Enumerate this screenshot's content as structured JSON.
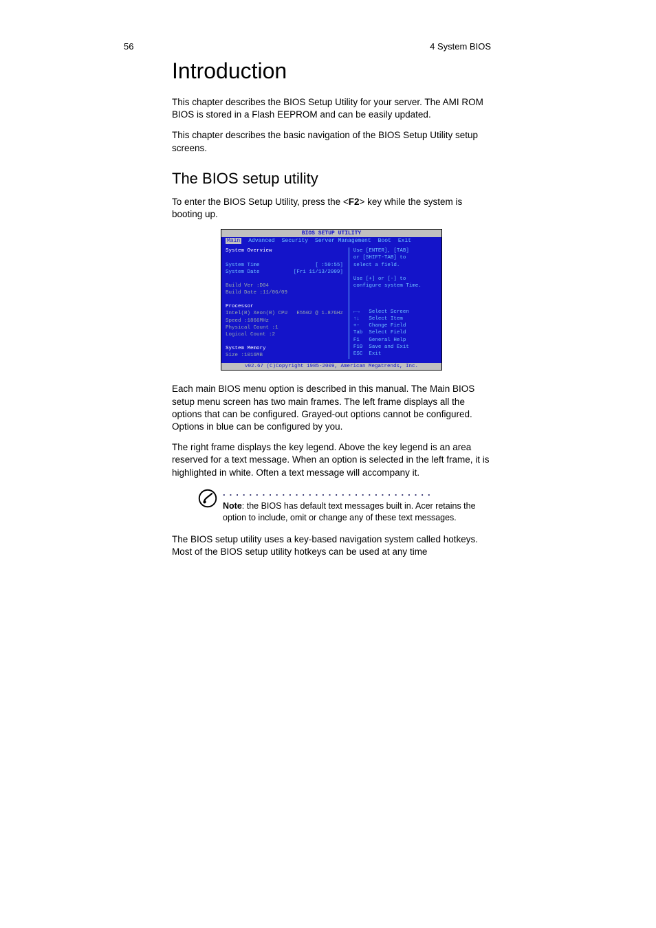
{
  "header": {
    "page_number": "56",
    "section": "4 System BIOS"
  },
  "title": "Introduction",
  "paragraphs": {
    "intro1": "This chapter describes the BIOS Setup Utility for your server. The AMI ROM BIOS is stored in a Flash EEPROM and can be easily updated.",
    "intro2": "This chapter describes the basic navigation of the BIOS Setup Utility setup screens.",
    "enter_pre": "To enter the BIOS Setup Utility, press the <",
    "enter_key": "F2",
    "enter_post": "> key while the system is booting up.",
    "desc1": "Each main BIOS menu option is described in this manual. The Main BIOS setup menu screen has two main frames. The left frame displays all the options that can be configured. Grayed-out options cannot be configured. Options in blue can be configured by you.",
    "desc2": "The right frame displays the key legend. Above the key legend is an area reserved for a text message. When an option is selected in the left frame, it is highlighted in white. Often a text message will accompany it.",
    "note_label": "Note",
    "note_text": ": the BIOS has default text messages built in. Acer retains the option to include, omit or change any of these text messages.",
    "desc3": "The BIOS setup utility uses a key-based navigation system called hotkeys. Most of the BIOS setup utility hotkeys can be used at any time"
  },
  "subtitle": "The BIOS setup utility",
  "bios": {
    "title": "BIOS SETUP UTILITY",
    "menu": [
      "Main",
      "Advanced",
      "Security",
      "Server Management",
      "Boot",
      "Exit"
    ],
    "left": {
      "overview": "System Overview",
      "time_label": "System Time",
      "time_value": "[  :50:55]",
      "date_label": "System Date",
      "date_value": "[Fri 11/13/2009]",
      "build_ver": "Build Ver  :D04",
      "build_date": "Build Date :11/06/09",
      "proc_hdr": "Processor",
      "proc_name_l": "Intel(R) Xeon(R) CPU",
      "proc_name_r": "E5502  @ 1.87GHz",
      "proc_speed": "Speed          :1866MHz",
      "proc_phys": "Physical Count :1",
      "proc_log": "Logical Count  :2",
      "mem_hdr": "System Memory",
      "mem_size": "Size       :1016MB"
    },
    "right": {
      "help1": "Use [ENTER], [TAB]",
      "help2": "or [SHIFT-TAB] to",
      "help3": "select a field.",
      "help4": "Use [+] or [-] to",
      "help5": "configure system Time.",
      "keys": "←→   Select Screen\n↑↓   Select Item\n+-   Change Field\nTab  Select Field\nF1   General Help\nF10  Save and Exit\nESC  Exit"
    },
    "footer": "v02.67 (C)Copyright 1985-2009, American Megatrends, Inc."
  }
}
